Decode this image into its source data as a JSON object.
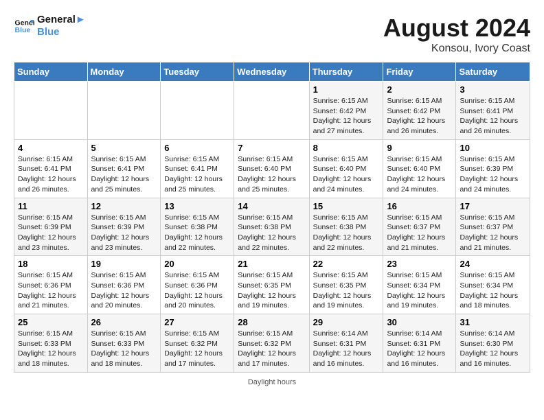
{
  "header": {
    "logo_line1": "General",
    "logo_line2": "Blue",
    "month_title": "August 2024",
    "location": "Konsou, Ivory Coast"
  },
  "days_of_week": [
    "Sunday",
    "Monday",
    "Tuesday",
    "Wednesday",
    "Thursday",
    "Friday",
    "Saturday"
  ],
  "weeks": [
    [
      {
        "num": "",
        "info": ""
      },
      {
        "num": "",
        "info": ""
      },
      {
        "num": "",
        "info": ""
      },
      {
        "num": "",
        "info": ""
      },
      {
        "num": "1",
        "info": "Sunrise: 6:15 AM\nSunset: 6:42 PM\nDaylight: 12 hours\nand 27 minutes."
      },
      {
        "num": "2",
        "info": "Sunrise: 6:15 AM\nSunset: 6:42 PM\nDaylight: 12 hours\nand 26 minutes."
      },
      {
        "num": "3",
        "info": "Sunrise: 6:15 AM\nSunset: 6:41 PM\nDaylight: 12 hours\nand 26 minutes."
      }
    ],
    [
      {
        "num": "4",
        "info": "Sunrise: 6:15 AM\nSunset: 6:41 PM\nDaylight: 12 hours\nand 26 minutes."
      },
      {
        "num": "5",
        "info": "Sunrise: 6:15 AM\nSunset: 6:41 PM\nDaylight: 12 hours\nand 25 minutes."
      },
      {
        "num": "6",
        "info": "Sunrise: 6:15 AM\nSunset: 6:41 PM\nDaylight: 12 hours\nand 25 minutes."
      },
      {
        "num": "7",
        "info": "Sunrise: 6:15 AM\nSunset: 6:40 PM\nDaylight: 12 hours\nand 25 minutes."
      },
      {
        "num": "8",
        "info": "Sunrise: 6:15 AM\nSunset: 6:40 PM\nDaylight: 12 hours\nand 24 minutes."
      },
      {
        "num": "9",
        "info": "Sunrise: 6:15 AM\nSunset: 6:40 PM\nDaylight: 12 hours\nand 24 minutes."
      },
      {
        "num": "10",
        "info": "Sunrise: 6:15 AM\nSunset: 6:39 PM\nDaylight: 12 hours\nand 24 minutes."
      }
    ],
    [
      {
        "num": "11",
        "info": "Sunrise: 6:15 AM\nSunset: 6:39 PM\nDaylight: 12 hours\nand 23 minutes."
      },
      {
        "num": "12",
        "info": "Sunrise: 6:15 AM\nSunset: 6:39 PM\nDaylight: 12 hours\nand 23 minutes."
      },
      {
        "num": "13",
        "info": "Sunrise: 6:15 AM\nSunset: 6:38 PM\nDaylight: 12 hours\nand 22 minutes."
      },
      {
        "num": "14",
        "info": "Sunrise: 6:15 AM\nSunset: 6:38 PM\nDaylight: 12 hours\nand 22 minutes."
      },
      {
        "num": "15",
        "info": "Sunrise: 6:15 AM\nSunset: 6:38 PM\nDaylight: 12 hours\nand 22 minutes."
      },
      {
        "num": "16",
        "info": "Sunrise: 6:15 AM\nSunset: 6:37 PM\nDaylight: 12 hours\nand 21 minutes."
      },
      {
        "num": "17",
        "info": "Sunrise: 6:15 AM\nSunset: 6:37 PM\nDaylight: 12 hours\nand 21 minutes."
      }
    ],
    [
      {
        "num": "18",
        "info": "Sunrise: 6:15 AM\nSunset: 6:36 PM\nDaylight: 12 hours\nand 21 minutes."
      },
      {
        "num": "19",
        "info": "Sunrise: 6:15 AM\nSunset: 6:36 PM\nDaylight: 12 hours\nand 20 minutes."
      },
      {
        "num": "20",
        "info": "Sunrise: 6:15 AM\nSunset: 6:36 PM\nDaylight: 12 hours\nand 20 minutes."
      },
      {
        "num": "21",
        "info": "Sunrise: 6:15 AM\nSunset: 6:35 PM\nDaylight: 12 hours\nand 19 minutes."
      },
      {
        "num": "22",
        "info": "Sunrise: 6:15 AM\nSunset: 6:35 PM\nDaylight: 12 hours\nand 19 minutes."
      },
      {
        "num": "23",
        "info": "Sunrise: 6:15 AM\nSunset: 6:34 PM\nDaylight: 12 hours\nand 19 minutes."
      },
      {
        "num": "24",
        "info": "Sunrise: 6:15 AM\nSunset: 6:34 PM\nDaylight: 12 hours\nand 18 minutes."
      }
    ],
    [
      {
        "num": "25",
        "info": "Sunrise: 6:15 AM\nSunset: 6:33 PM\nDaylight: 12 hours\nand 18 minutes."
      },
      {
        "num": "26",
        "info": "Sunrise: 6:15 AM\nSunset: 6:33 PM\nDaylight: 12 hours\nand 18 minutes."
      },
      {
        "num": "27",
        "info": "Sunrise: 6:15 AM\nSunset: 6:32 PM\nDaylight: 12 hours\nand 17 minutes."
      },
      {
        "num": "28",
        "info": "Sunrise: 6:15 AM\nSunset: 6:32 PM\nDaylight: 12 hours\nand 17 minutes."
      },
      {
        "num": "29",
        "info": "Sunrise: 6:14 AM\nSunset: 6:31 PM\nDaylight: 12 hours\nand 16 minutes."
      },
      {
        "num": "30",
        "info": "Sunrise: 6:14 AM\nSunset: 6:31 PM\nDaylight: 12 hours\nand 16 minutes."
      },
      {
        "num": "31",
        "info": "Sunrise: 6:14 AM\nSunset: 6:30 PM\nDaylight: 12 hours\nand 16 minutes."
      }
    ]
  ],
  "footer": {
    "daylight_label": "Daylight hours"
  }
}
